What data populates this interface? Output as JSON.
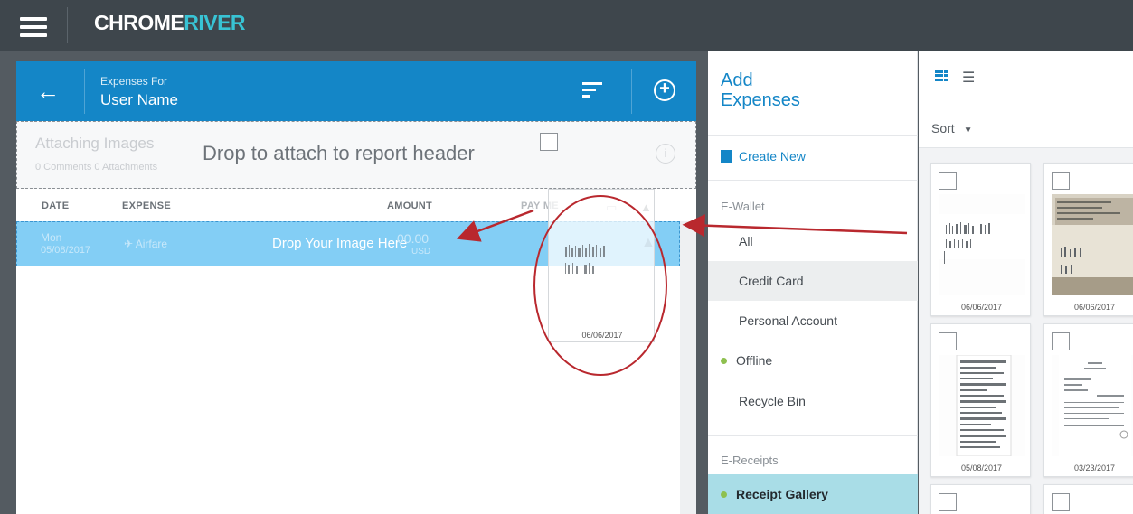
{
  "app": {
    "logo_main": "CHROME",
    "logo_accent": "RIVER"
  },
  "report": {
    "header_label": "Expenses For",
    "header_name": "User Name",
    "attaching_title": "Attaching Images",
    "attaching_meta": "0 Comments   0 Attachments",
    "drop_header_text": "Drop to attach to report header",
    "columns": {
      "date": "DATE",
      "expense": "EXPENSE",
      "amount": "AMOUNT",
      "payme": "PAY ME"
    },
    "row": {
      "day": "Mon",
      "date": "05/08/2017",
      "type": "Airfare",
      "drop_text": "Drop Your Image Here",
      "amount": "00.00",
      "currency": "USD"
    },
    "ghost_date": "06/06/2017"
  },
  "add_expenses": {
    "title_line1": "Add",
    "title_line2": "Expenses",
    "create_new": "Create New",
    "ewallet_label": "E-Wallet",
    "items": [
      {
        "label": "All"
      },
      {
        "label": "Credit Card"
      },
      {
        "label": "Personal Account"
      },
      {
        "label": "Offline"
      },
      {
        "label": "Recycle Bin"
      }
    ],
    "ereceipts_label": "E-Receipts",
    "gallery_item": "Receipt Gallery"
  },
  "gallery": {
    "sort_label": "Sort",
    "cards": [
      {
        "date": "06/06/2017"
      },
      {
        "date": "06/06/2017"
      },
      {
        "date": "05/08/2017"
      },
      {
        "date": "03/23/2017"
      }
    ]
  },
  "colors": {
    "brand_blue": "#1486c7",
    "drop_row": "#83cef5",
    "annotation_red": "#b9282e",
    "online_dot": "#8ec04f"
  }
}
